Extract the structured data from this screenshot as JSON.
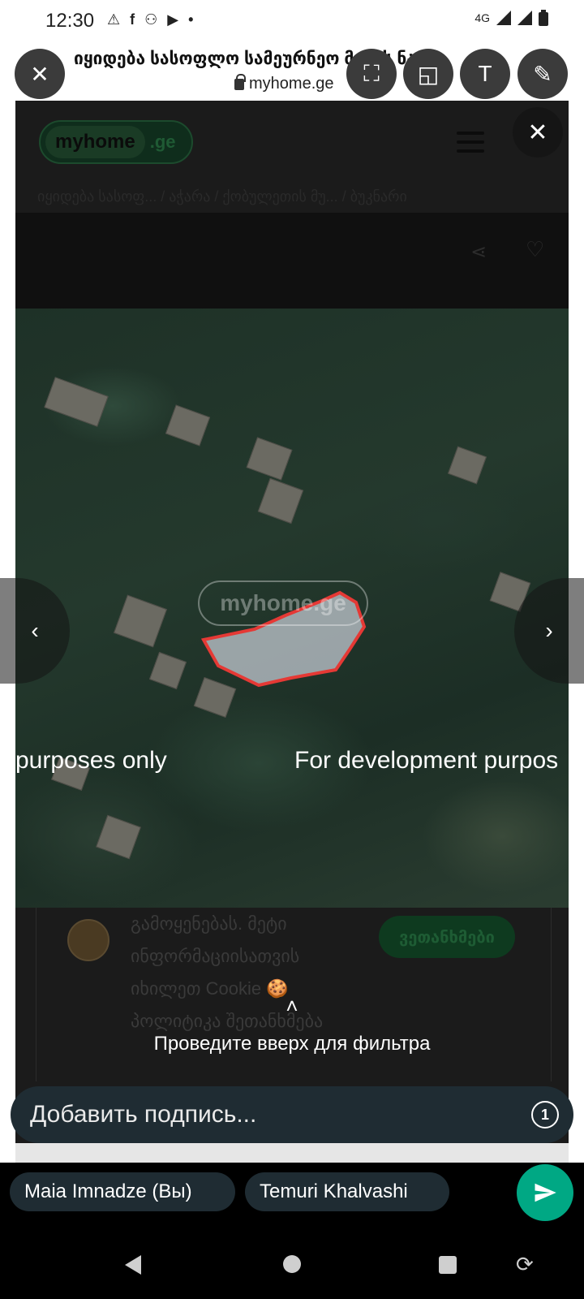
{
  "status_bar": {
    "time": "12:30",
    "network": "4G",
    "left_icons": [
      "warning-icon",
      "facebook-icon",
      "notification-icon",
      "youtube-icon",
      "dot-icon"
    ],
    "right_icons": [
      "4g-signal-icon",
      "r-signal-icon",
      "battery-icon"
    ]
  },
  "browser": {
    "page_title": "იყიდება სასოფლო სამეურნეო მიწის ნაკ...",
    "url": "myhome.ge"
  },
  "editor_tools": {
    "close": "✕",
    "crop": "⛶",
    "sticker": "◱",
    "text": "T",
    "draw": "✎"
  },
  "website": {
    "logo_main": "myhome",
    "logo_suffix": ".ge",
    "breadcrumb": "იყიდება სასოფ... / აჭარა / ქობულეთის მუ... / ბუკნარი",
    "overlay_close": "✕",
    "share": "⋖",
    "favorite": "♡"
  },
  "photo": {
    "watermark": "myhome.ge",
    "dev_text_left": "purposes only",
    "dev_text_right": "For development purpos",
    "prev": "‹",
    "next": "›"
  },
  "cookie_banner": {
    "text": "გამოყენებას. მეტი ინფორმაციისათვის იხილეთ Cookie 🍪 პოლიტიკა შეთანხმება",
    "accept": "ვეთანხმები"
  },
  "swipe_hint": {
    "chevron": "˄",
    "text": "Проведите вверх для фильтра"
  },
  "caption": {
    "placeholder": "Добавить подпись...",
    "timer": "1"
  },
  "recipients": [
    {
      "name": "Maia Imnadze (Вы)"
    },
    {
      "name": "Temuri Khalvashi"
    }
  ],
  "colors": {
    "send_button": "#00a884",
    "chip_background": "#1f2c33",
    "parcel_outline": "#e53935"
  }
}
